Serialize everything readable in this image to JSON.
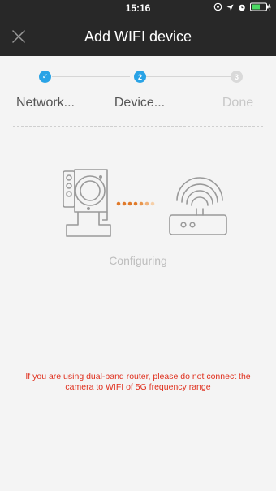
{
  "status_bar": {
    "time": "15:16",
    "icons": [
      "location-icon",
      "arrow-icon",
      "alarm-icon",
      "battery-icon"
    ]
  },
  "header": {
    "title": "Add WIFI device",
    "close_icon": "close-icon"
  },
  "stepper": {
    "steps": [
      {
        "label": "Network...",
        "state": "completed",
        "marker": "✓"
      },
      {
        "label": "Device...",
        "state": "current",
        "marker": "2"
      },
      {
        "label": "Done",
        "state": "pending",
        "marker": "3"
      }
    ]
  },
  "illustration": {
    "camera_icon": "camera-icon",
    "router_icon": "router-icon"
  },
  "status_text": "Configuring",
  "warning_text": "If you are using dual-band router, please do not connect the camera to WIFI of 5G frequency range",
  "colors": {
    "header_bg": "#282828",
    "accent": "#29a3e6",
    "pending": "#d6d6d6",
    "progress_dot": "#e07a2a",
    "warning": "#e0301e",
    "background": "#f4f4f4"
  }
}
